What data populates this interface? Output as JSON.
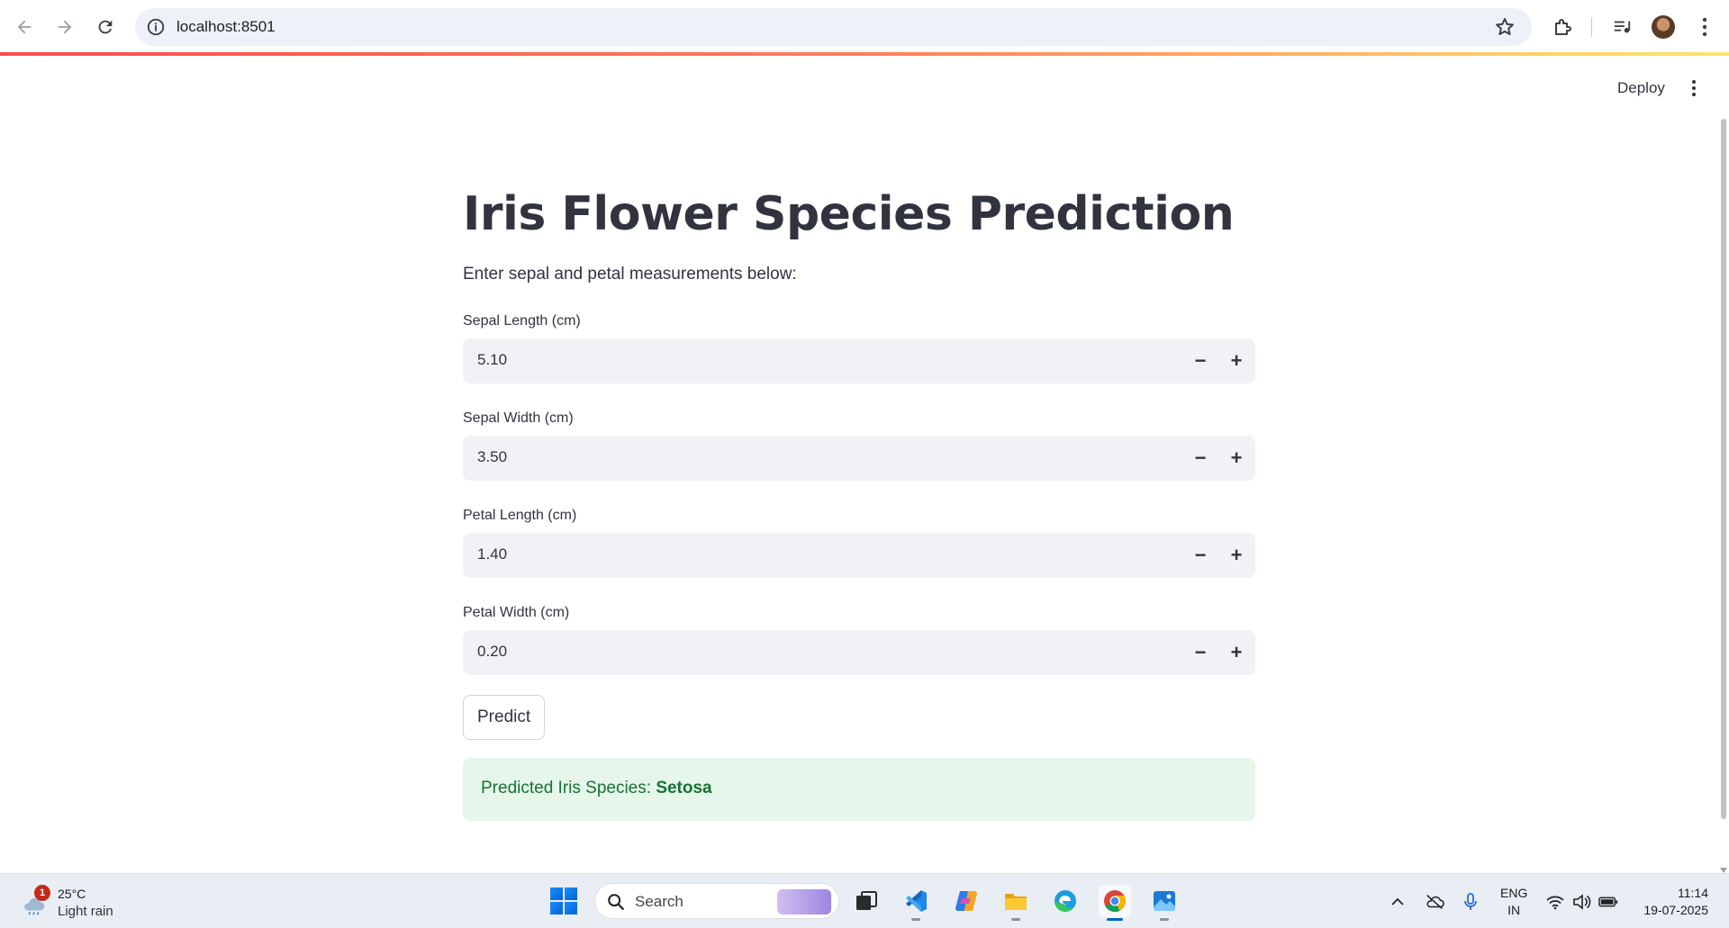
{
  "browser": {
    "url": "localhost:8501"
  },
  "app_header": {
    "deploy_label": "Deploy"
  },
  "main": {
    "title": "Iris Flower Species Prediction",
    "subtitle": "Enter sepal and petal measurements below:",
    "fields": [
      {
        "label": "Sepal Length (cm)",
        "value": "5.10"
      },
      {
        "label": "Sepal Width (cm)",
        "value": "3.50"
      },
      {
        "label": "Petal Length (cm)",
        "value": "1.40"
      },
      {
        "label": "Petal Width (cm)",
        "value": "0.20"
      }
    ],
    "stepper": {
      "minus": "−",
      "plus": "+"
    },
    "predict_label": "Predict",
    "result": {
      "prefix": "Predicted Iris Species: ",
      "species": "Setosa"
    }
  },
  "taskbar": {
    "weather": {
      "badge": "1",
      "temp": "25°C",
      "condition": "Light rain"
    },
    "search_label": "Search",
    "lang_line1": "ENG",
    "lang_line2": "IN",
    "time": "11:14",
    "date": "19-07-2025"
  },
  "colors": {
    "accent": "#ff4b4b",
    "success_bg": "#e6f6ea",
    "success_text": "#177233",
    "input_bg": "#f0f2f6"
  },
  "icons": [
    "back-arrow-icon",
    "forward-arrow-icon",
    "reload-icon",
    "info-icon",
    "star-icon",
    "extensions-icon",
    "media-control-icon",
    "chrome-menu-icon",
    "streamlit-menu-icon",
    "weather-cloud-icon",
    "windows-start-icon",
    "search-icon",
    "task-view-icon",
    "vscode-icon",
    "copilot-icon",
    "file-explorer-icon",
    "edge-icon",
    "chrome-icon",
    "photos-icon",
    "chevron-up-icon",
    "onedrive-icon",
    "microphone-icon",
    "wifi-icon",
    "volume-icon",
    "battery-icon"
  ]
}
